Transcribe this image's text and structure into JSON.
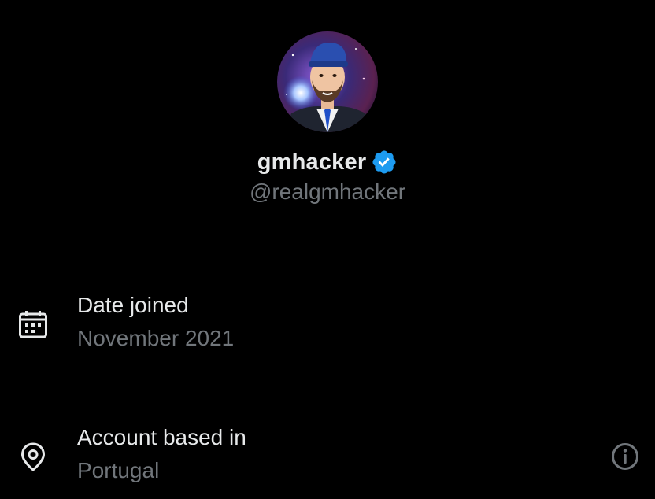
{
  "profile": {
    "display_name": "gmhacker",
    "handle": "@realgmhacker",
    "verified": true,
    "verified_color": "#1d9bf0"
  },
  "about": {
    "date_joined": {
      "icon": "calendar-icon",
      "title": "Date joined",
      "value": "November 2021"
    },
    "account_based_in": {
      "icon": "location-pin-icon",
      "title": "Account based in",
      "value": "Portugal",
      "action_icon": "info-icon"
    }
  },
  "colors": {
    "background": "#000000",
    "primary_text": "#e7e9ea",
    "secondary_text": "#71767b"
  }
}
